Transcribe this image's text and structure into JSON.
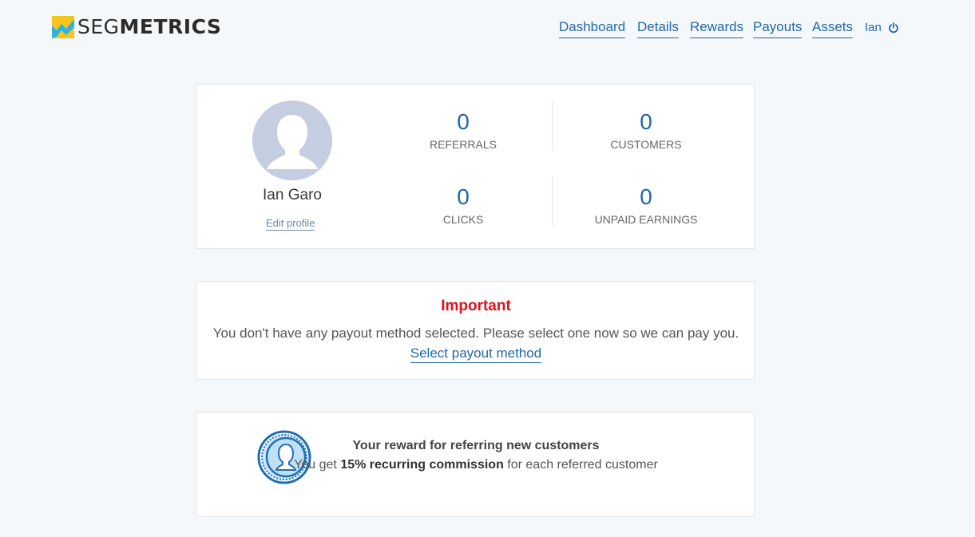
{
  "brand": {
    "name_light": "SEG",
    "name_bold": "METRICS",
    "colors": {
      "yellow": "#f6c51b",
      "blue": "#2bb3e4",
      "text": "#2b2b2b"
    }
  },
  "nav": {
    "items": [
      {
        "label": "Dashboard"
      },
      {
        "label": "Details"
      },
      {
        "label": "Rewards"
      },
      {
        "label": "Payouts"
      },
      {
        "label": "Assets"
      }
    ],
    "user_name": "Ian",
    "logout_icon": "power-icon"
  },
  "profile": {
    "name": "Ian Garo",
    "edit_label": "Edit profile",
    "avatar_icon": "user-silhouette-icon",
    "stats": [
      {
        "value": "0",
        "label": "REFERRALS"
      },
      {
        "value": "0",
        "label": "CUSTOMERS"
      },
      {
        "value": "0",
        "label": "CLICKS"
      },
      {
        "value": "0",
        "label": "UNPAID EARNINGS"
      }
    ]
  },
  "important": {
    "title": "Important",
    "message": "You don't have any payout method selected. Please select one now so we can pay you.",
    "link_label": "Select payout method",
    "title_color": "#e0101e"
  },
  "reward": {
    "coin_icon": "coin-icon",
    "title": "Your reward for referring new customers",
    "desc_prefix": "You get ",
    "desc_bold": "15% recurring commission",
    "desc_suffix": " for each referred customer"
  },
  "colors": {
    "accent": "#2268a6",
    "background": "#f4f8fb"
  }
}
